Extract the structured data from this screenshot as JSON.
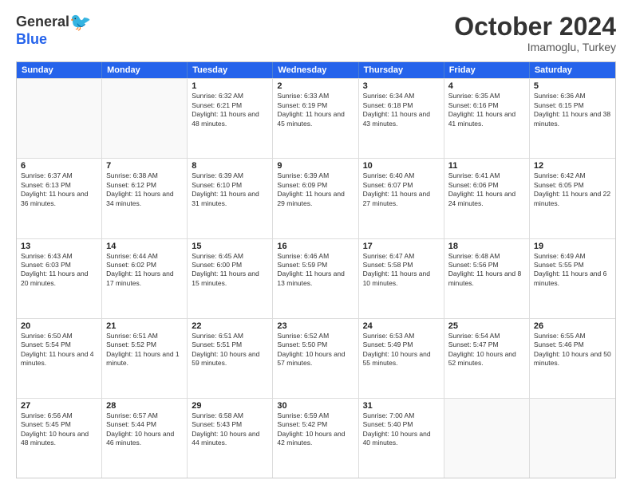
{
  "logo": {
    "general": "General",
    "blue": "Blue"
  },
  "title": "October 2024",
  "location": "Imamoglu, Turkey",
  "header_days": [
    "Sunday",
    "Monday",
    "Tuesday",
    "Wednesday",
    "Thursday",
    "Friday",
    "Saturday"
  ],
  "weeks": [
    [
      {
        "day": "",
        "empty": true
      },
      {
        "day": "",
        "empty": true
      },
      {
        "day": "1",
        "sunrise": "6:32 AM",
        "sunset": "6:21 PM",
        "daylight": "11 hours and 48 minutes."
      },
      {
        "day": "2",
        "sunrise": "6:33 AM",
        "sunset": "6:19 PM",
        "daylight": "11 hours and 45 minutes."
      },
      {
        "day": "3",
        "sunrise": "6:34 AM",
        "sunset": "6:18 PM",
        "daylight": "11 hours and 43 minutes."
      },
      {
        "day": "4",
        "sunrise": "6:35 AM",
        "sunset": "6:16 PM",
        "daylight": "11 hours and 41 minutes."
      },
      {
        "day": "5",
        "sunrise": "6:36 AM",
        "sunset": "6:15 PM",
        "daylight": "11 hours and 38 minutes."
      }
    ],
    [
      {
        "day": "6",
        "sunrise": "6:37 AM",
        "sunset": "6:13 PM",
        "daylight": "11 hours and 36 minutes."
      },
      {
        "day": "7",
        "sunrise": "6:38 AM",
        "sunset": "6:12 PM",
        "daylight": "11 hours and 34 minutes."
      },
      {
        "day": "8",
        "sunrise": "6:39 AM",
        "sunset": "6:10 PM",
        "daylight": "11 hours and 31 minutes."
      },
      {
        "day": "9",
        "sunrise": "6:39 AM",
        "sunset": "6:09 PM",
        "daylight": "11 hours and 29 minutes."
      },
      {
        "day": "10",
        "sunrise": "6:40 AM",
        "sunset": "6:07 PM",
        "daylight": "11 hours and 27 minutes."
      },
      {
        "day": "11",
        "sunrise": "6:41 AM",
        "sunset": "6:06 PM",
        "daylight": "11 hours and 24 minutes."
      },
      {
        "day": "12",
        "sunrise": "6:42 AM",
        "sunset": "6:05 PM",
        "daylight": "11 hours and 22 minutes."
      }
    ],
    [
      {
        "day": "13",
        "sunrise": "6:43 AM",
        "sunset": "6:03 PM",
        "daylight": "11 hours and 20 minutes."
      },
      {
        "day": "14",
        "sunrise": "6:44 AM",
        "sunset": "6:02 PM",
        "daylight": "11 hours and 17 minutes."
      },
      {
        "day": "15",
        "sunrise": "6:45 AM",
        "sunset": "6:00 PM",
        "daylight": "11 hours and 15 minutes."
      },
      {
        "day": "16",
        "sunrise": "6:46 AM",
        "sunset": "5:59 PM",
        "daylight": "11 hours and 13 minutes."
      },
      {
        "day": "17",
        "sunrise": "6:47 AM",
        "sunset": "5:58 PM",
        "daylight": "11 hours and 10 minutes."
      },
      {
        "day": "18",
        "sunrise": "6:48 AM",
        "sunset": "5:56 PM",
        "daylight": "11 hours and 8 minutes."
      },
      {
        "day": "19",
        "sunrise": "6:49 AM",
        "sunset": "5:55 PM",
        "daylight": "11 hours and 6 minutes."
      }
    ],
    [
      {
        "day": "20",
        "sunrise": "6:50 AM",
        "sunset": "5:54 PM",
        "daylight": "11 hours and 4 minutes."
      },
      {
        "day": "21",
        "sunrise": "6:51 AM",
        "sunset": "5:52 PM",
        "daylight": "11 hours and 1 minute."
      },
      {
        "day": "22",
        "sunrise": "6:51 AM",
        "sunset": "5:51 PM",
        "daylight": "10 hours and 59 minutes."
      },
      {
        "day": "23",
        "sunrise": "6:52 AM",
        "sunset": "5:50 PM",
        "daylight": "10 hours and 57 minutes."
      },
      {
        "day": "24",
        "sunrise": "6:53 AM",
        "sunset": "5:49 PM",
        "daylight": "10 hours and 55 minutes."
      },
      {
        "day": "25",
        "sunrise": "6:54 AM",
        "sunset": "5:47 PM",
        "daylight": "10 hours and 52 minutes."
      },
      {
        "day": "26",
        "sunrise": "6:55 AM",
        "sunset": "5:46 PM",
        "daylight": "10 hours and 50 minutes."
      }
    ],
    [
      {
        "day": "27",
        "sunrise": "6:56 AM",
        "sunset": "5:45 PM",
        "daylight": "10 hours and 48 minutes."
      },
      {
        "day": "28",
        "sunrise": "6:57 AM",
        "sunset": "5:44 PM",
        "daylight": "10 hours and 46 minutes."
      },
      {
        "day": "29",
        "sunrise": "6:58 AM",
        "sunset": "5:43 PM",
        "daylight": "10 hours and 44 minutes."
      },
      {
        "day": "30",
        "sunrise": "6:59 AM",
        "sunset": "5:42 PM",
        "daylight": "10 hours and 42 minutes."
      },
      {
        "day": "31",
        "sunrise": "7:00 AM",
        "sunset": "5:40 PM",
        "daylight": "10 hours and 40 minutes."
      },
      {
        "day": "",
        "empty": true
      },
      {
        "day": "",
        "empty": true
      }
    ]
  ],
  "labels": {
    "sunrise": "Sunrise:",
    "sunset": "Sunset:",
    "daylight": "Daylight:"
  }
}
